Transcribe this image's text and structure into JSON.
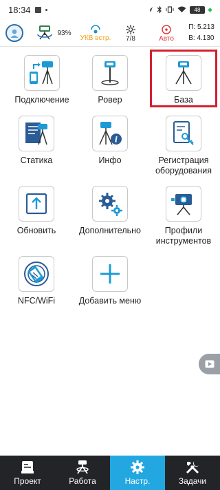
{
  "status_bar": {
    "time": "18:34",
    "battery": "48"
  },
  "header": {
    "battery_percent": "93%",
    "radio_label": "УКВ встр.",
    "satellites": "7/8",
    "mode_label": "Авто",
    "coord_p": "П: 5.213",
    "coord_v": "В: 4.130"
  },
  "menu": {
    "items": [
      {
        "label": "Подключение"
      },
      {
        "label": "Ровер"
      },
      {
        "label": "База"
      },
      {
        "label": "Статика"
      },
      {
        "label": "Инфо"
      },
      {
        "label": "Регистрация\nоборудования"
      },
      {
        "label": "Обновить"
      },
      {
        "label": "Дополнительно"
      },
      {
        "label": "Профили\nинструментов"
      },
      {
        "label": "NFC/WiFi"
      },
      {
        "label": "Добавить меню"
      }
    ]
  },
  "bottom_nav": {
    "tabs": [
      {
        "label": "Проект",
        "icon": "project-icon"
      },
      {
        "label": "Работа",
        "icon": "survey-icon"
      },
      {
        "label": "Настр.",
        "icon": "gear-icon"
      },
      {
        "label": "Задачи",
        "icon": "tools-icon"
      }
    ],
    "active_index": 2
  },
  "colors": {
    "accent": "#23a7e0",
    "highlight_border": "#d3202f",
    "radio_text": "#f0a21b",
    "mode_text": "#e23b3b",
    "nav_bg": "#222428"
  }
}
